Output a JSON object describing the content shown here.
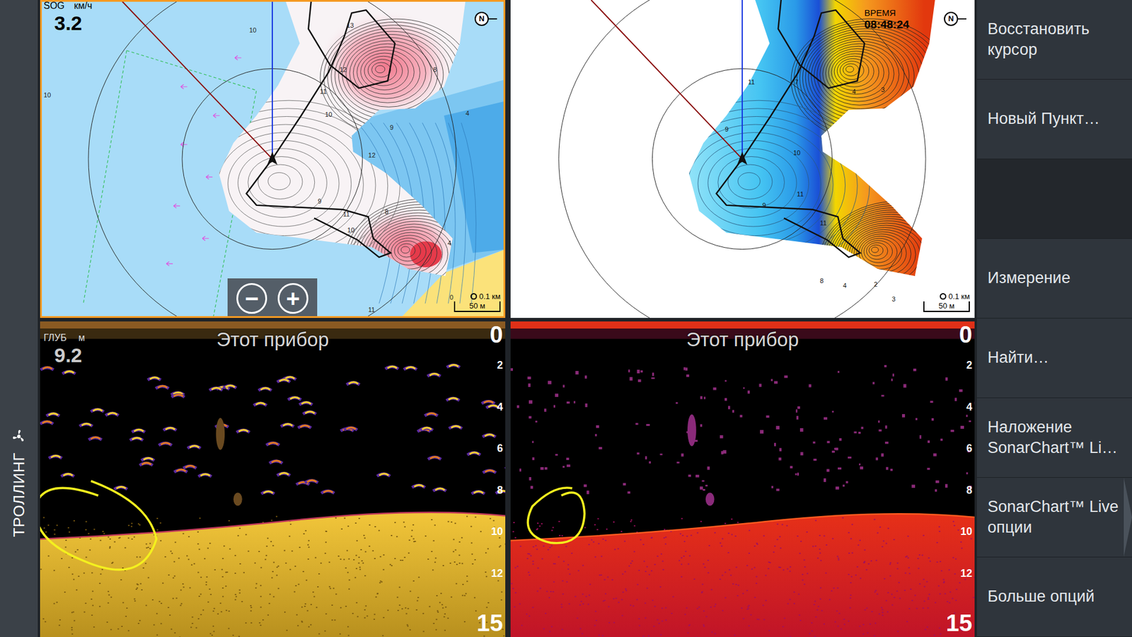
{
  "mode_bar": {
    "label": "ТРОЛЛИНГ"
  },
  "chart": {
    "selected": true,
    "sog_label": "SOG",
    "sog_unit": "км/ч",
    "sog_value": "3.2",
    "north": "N",
    "zoom_out": "−",
    "zoom_in": "+",
    "range": "0.1 км",
    "scale": "50 м",
    "depth_labels": [
      "10",
      "10",
      "13",
      "12",
      "11",
      "10",
      "9",
      "8",
      "4",
      "12",
      "9",
      "11",
      "10",
      "8",
      "4",
      "0",
      "11"
    ]
  },
  "contour_map": {
    "selected": false,
    "time_label": "ВРЕМЯ",
    "time": "08:48:24",
    "north": "N",
    "range": "0.1 км",
    "scale": "50 м",
    "depth_labels": [
      "9",
      "10",
      "11",
      "11",
      "8",
      "4",
      "9",
      "4",
      "3",
      "7",
      "11",
      "2",
      "3"
    ]
  },
  "sonar_left": {
    "source": "Этот прибор",
    "depth_label": "ГЛУБ",
    "depth_unit": "м",
    "depth": "9.2",
    "scale_top": "0",
    "scale_bottom": "15",
    "ticks": [
      "2",
      "4",
      "6",
      "8",
      "10",
      "12"
    ]
  },
  "sonar_right": {
    "source": "Этот прибор",
    "scale_top": "0",
    "scale_bottom": "15",
    "ticks": [
      "2",
      "4",
      "6",
      "8",
      "10",
      "12"
    ]
  },
  "menu": [
    {
      "label": "Восстановить курсор",
      "kind": "item",
      "submenu": false
    },
    {
      "label": "Новый Пункт…",
      "kind": "item",
      "submenu": false
    },
    {
      "label": "",
      "kind": "spacer",
      "submenu": false
    },
    {
      "label": "Измерение",
      "kind": "item",
      "submenu": false
    },
    {
      "label": "Найти…",
      "kind": "item",
      "submenu": false
    },
    {
      "label": "Наложение SonarChart™ Li…",
      "kind": "item",
      "submenu": false
    },
    {
      "label": "SonarChart™ Live опции",
      "kind": "item",
      "submenu": true
    },
    {
      "label": "Больше опций",
      "kind": "item",
      "submenu": false
    }
  ]
}
